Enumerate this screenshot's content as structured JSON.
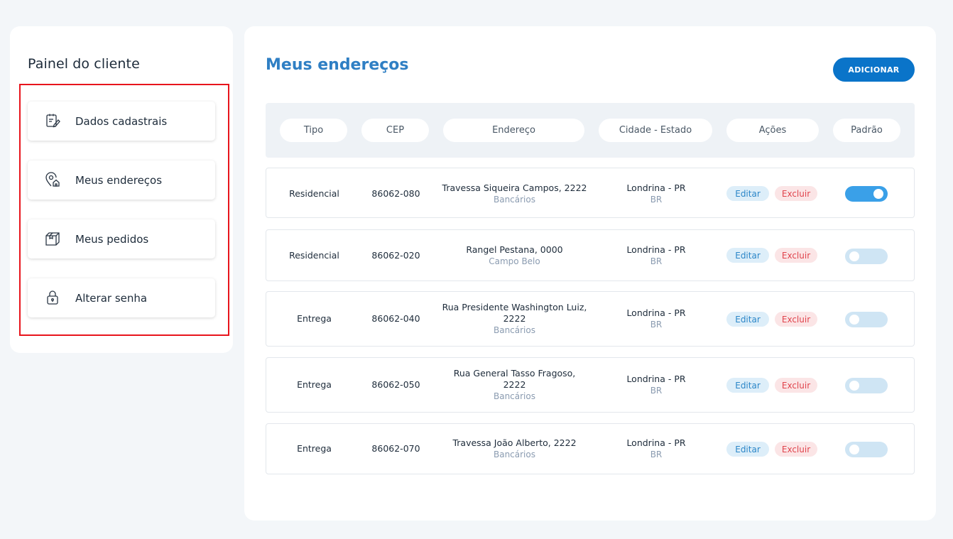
{
  "sidebar": {
    "title": "Painel do cliente",
    "items": [
      {
        "label": "Dados cadastrais",
        "icon": "form-edit-icon"
      },
      {
        "label": "Meus endereços",
        "icon": "location-home-icon"
      },
      {
        "label": "Meus pedidos",
        "icon": "box-icon"
      },
      {
        "label": "Alterar senha",
        "icon": "lock-icon"
      }
    ]
  },
  "main": {
    "title": "Meus endereços",
    "add_label": "ADICIONAR",
    "columns": [
      "Tipo",
      "CEP",
      "Endereço",
      "Cidade - Estado",
      "Ações",
      "Padrão"
    ],
    "rows": [
      {
        "tipo": "Residencial",
        "cep": "86062-080",
        "endereco_l1": "Travessa Siqueira Campos, 2222",
        "endereco_l2": "",
        "bairro": "Bancários",
        "cidade": "Londrina - PR",
        "pais": "BR",
        "edit": "Editar",
        "delete": "Excluir",
        "padrao": true
      },
      {
        "tipo": "Residencial",
        "cep": "86062-020",
        "endereco_l1": "Rangel Pestana, 0000",
        "endereco_l2": "",
        "bairro": "Campo Belo",
        "cidade": "Londrina - PR",
        "pais": "BR",
        "edit": "Editar",
        "delete": "Excluir",
        "padrao": false
      },
      {
        "tipo": "Entrega",
        "cep": "86062-040",
        "endereco_l1": "Rua Presidente Washington Luiz,",
        "endereco_l2": "2222",
        "bairro": "Bancários",
        "cidade": "Londrina - PR",
        "pais": "BR",
        "edit": "Editar",
        "delete": "Excluir",
        "padrao": false
      },
      {
        "tipo": "Entrega",
        "cep": "86062-050",
        "endereco_l1": "Rua General Tasso Fragoso,",
        "endereco_l2": "2222",
        "bairro": "Bancários",
        "cidade": "Londrina - PR",
        "pais": "BR",
        "edit": "Editar",
        "delete": "Excluir",
        "padrao": false
      },
      {
        "tipo": "Entrega",
        "cep": "86062-070",
        "endereco_l1": "Travessa João Alberto, 2222",
        "endereco_l2": "",
        "bairro": "Bancários",
        "cidade": "Londrina - PR",
        "pais": "BR",
        "edit": "Editar",
        "delete": "Excluir",
        "padrao": false
      }
    ]
  },
  "colors": {
    "accent": "#0a74c9",
    "title": "#2f7fc4",
    "highlight": "#e8141c",
    "toggle_on": "#3aa0e8",
    "toggle_off": "#cfe5f4"
  }
}
